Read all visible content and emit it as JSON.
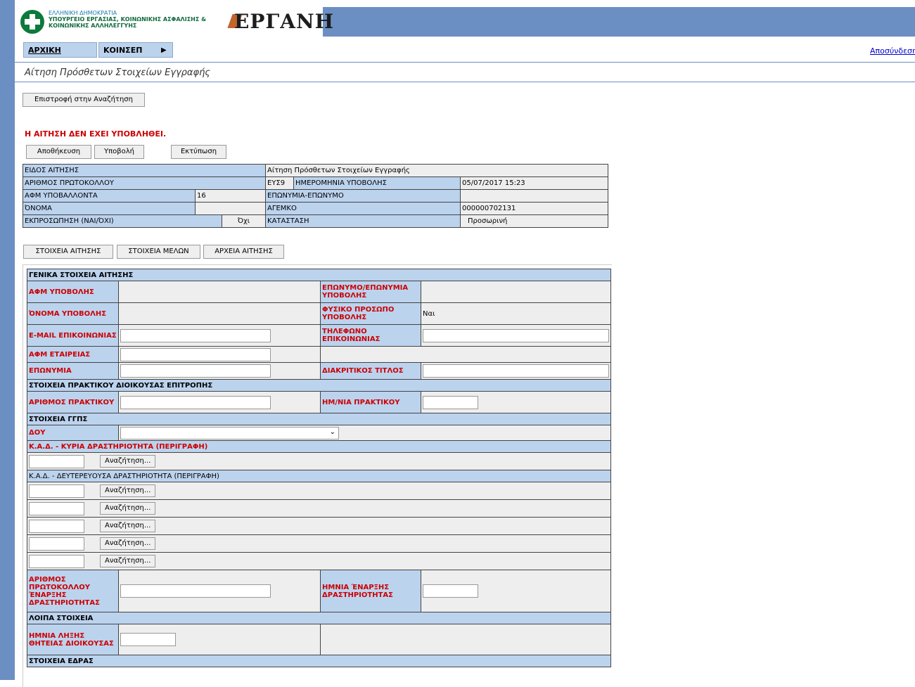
{
  "header": {
    "ministry_line1": "ΕΛΛΗΝΙΚΗ ΔΗΜΟΚΡΑΤΙΑ",
    "ministry_line2": "ΥΠΟΥΡΓΕΙΟ ΕΡΓΑΣΙΑΣ, ΚΟΙΝΩΝΙΚΗΣ ΑΣΦΑΛΙΣΗΣ &",
    "ministry_line3": "ΚΟΙΝΩΝΙΚΗΣ ΑΛΛΗΛΕΓΓΥΗΣ",
    "brand": "ΕΡΓΑΝΗ"
  },
  "menu": {
    "home": "ΑΡΧΙΚΗ",
    "koinsep": "ΚΟΙΝΣΕΠ",
    "arrow": "▶",
    "logout": "Αποσύνδεση"
  },
  "page": {
    "title": "Αίτηση Πρόσθετων Στοιχείων Εγγραφής",
    "back_button": "Επιστροφή στην Αναζήτηση",
    "status": "Η ΑΙΤΗΣΗ ΔΕΝ ΕΧΕΙ ΥΠΟΒΛΗΘΕΙ.",
    "save": "Αποθήκευση",
    "submit": "Υποβολή",
    "print": "Εκτύπωση"
  },
  "info": {
    "type_label": "ΕΙΔΟΣ ΑΙΤΗΣΗΣ",
    "type_value": "Αίτηση Πρόσθετων Στοιχείων Εγγραφής",
    "protocol_label": "ΑΡΙΘΜΟΣ ΠΡΩΤΟΚΟΛΛΟΥ",
    "protocol_code": "ΕΥΣ9",
    "date_label": "ΗΜΕΡΟΜΗΝΙΑ ΥΠΟΒΟΛΗΣ",
    "date_value": "05/07/2017 15:23",
    "afm_label": "ΑΦΜ ΥΠΟΒΑΛΛΟΝΤΑ",
    "afm_value": "16",
    "surname_label": "ΕΠΩΝΥΜΙΑ-ΕΠΩΝΥΜΟ",
    "surname_value": "",
    "name_label": "ΌΝΟΜΑ",
    "name_value": "",
    "gemi_label": "ΑΓΕΜΚΟ",
    "gemi_value": "000000702131",
    "rep_label": "ΕΚΠΡΟΣΩΠΗΣΗ (ΝΑΙ/ΌΧΙ)",
    "rep_value": "Όχι",
    "state_label": "ΚΑΤΑΣΤΑΣΗ",
    "state_value": "Προσωρινή"
  },
  "tabs": [
    "ΣΤΟΙΧΕΙΑ ΑΙΤΗΣΗΣ",
    "ΣΤΟΙΧΕΙΑ ΜΕΛΩΝ",
    "ΑΡΧΕΙΑ ΑΙΤΗΣΗΣ"
  ],
  "form": {
    "sec_general": "ΓΕΝΙΚΑ ΣΤΟΙΧΕΙΑ ΑΙΤΗΣΗΣ",
    "afm_sub": "ΑΦΜ ΥΠΟΒΟΛΗΣ",
    "surname_sub": "ΕΠΩΝΥΜΟ/ΕΠΩΝΥΜΙΑ ΥΠΟΒΟΛΗΣ",
    "name_sub": "ΌΝΟΜΑ ΥΠΟΒΟΛΗΣ",
    "natural": "ΦΥΣΙΚΟ ΠΡΟΣΩΠΟ ΥΠΟΒΟΛΗΣ",
    "natural_value": "Ναι",
    "email": "E-MAIL ΕΠΙΚΟΙΝΩΝΙΑΣ",
    "phone": "ΤΗΛΕΦΩΝΟ ΕΠΙΚΟΙΝΩΝΙΑΣ",
    "afm_company": "ΑΦΜ ΕΤΑΙΡΕΙΑΣ",
    "company_name": "ΕΠΩΝΥΜΙΑ",
    "distinctive": "ΔΙΑΚΡΙΤΙΚΟΣ ΤΙΤΛΟΣ",
    "sec_board": "ΣΤΟΙΧΕΙΑ ΠΡΑΚΤΙΚΟΥ ΔΙΟΙΚΟΥΣΑΣ ΕΠΙΤΡΟΠΗΣ",
    "minutes_no": "ΑΡΙΘΜΟΣ ΠΡΑΚΤΙΚΟΥ",
    "minutes_date": "ΗΜ/ΝΙΑ ΠΡΑΚΤΙΚΟΥ",
    "sec_ggps": "ΣΤΟΙΧΕΙΑ ΓΓΠΣ",
    "doy": "ΔΟΥ",
    "sec_kad_main": "Κ.Α.Δ. - ΚΥΡΙΑ ΔΡΑΣΤΗΡΙΟΤΗΤΑ (ΠΕΡΙΓΡΑΦΗ)",
    "search": "Αναζήτηση...",
    "sec_kad_secondary": "Κ.Α.Δ. - ΔΕΥΤΕΡΕΥΟΥΣΑ ΔΡΑΣΤΗΡΙΟΤΗΤΑ (ΠΕΡΙΓΡΑΦΗ)",
    "start_protocol": "ΑΡΙΘΜΟΣ ΠΡΩΤΟΚΟΛΛΟΥ ΈΝΑΡΞΗΣ ΔΡΑΣΤΗΡΙΟΤΗΤΑΣ",
    "start_date": "ΗΜΝΙΑ ΈΝΑΡΞΗΣ ΔΡΑΣΤΗΡΙΟΤΗΤΑΣ",
    "sec_other": "ΛΟΙΠΑ ΣΤΟΙΧΕΙΑ",
    "term_end": "ΗΜΝΙΑ ΛΗΞΗΣ ΘΗΤΕΙΑΣ ΔΙΟΙΚΟΥΣΑΣ",
    "sec_seat": "ΣΤΟΙΧΕΙΑ ΕΔΡΑΣ"
  }
}
